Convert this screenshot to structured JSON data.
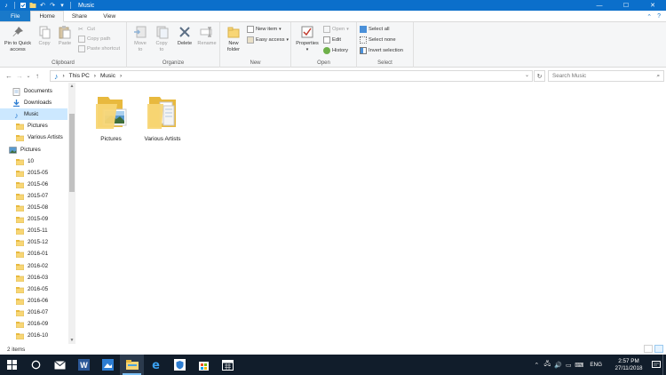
{
  "window": {
    "title": "Music",
    "controls": {
      "minimize": "—",
      "maximize": "☐",
      "close": "✕"
    }
  },
  "ribbon_tabs": [
    "File",
    "Home",
    "Share",
    "View"
  ],
  "ribbon": {
    "clipboard": {
      "label": "Clipboard",
      "pin": "Pin to Quick\naccess",
      "copy": "Copy",
      "paste": "Paste",
      "cut": "Cut",
      "copy_path": "Copy path",
      "paste_shortcut": "Paste shortcut"
    },
    "organize": {
      "label": "Organize",
      "move_to": "Move\nto",
      "copy_to": "Copy\nto",
      "delete": "Delete",
      "rename": "Rename"
    },
    "new": {
      "label": "New",
      "new_folder": "New\nfolder",
      "new_item": "New item",
      "easy_access": "Easy access"
    },
    "open": {
      "label": "Open",
      "properties": "Properties",
      "open": "Open",
      "edit": "Edit",
      "history": "History"
    },
    "select": {
      "label": "Select",
      "select_all": "Select all",
      "select_none": "Select none",
      "invert": "Invert selection"
    }
  },
  "address": {
    "breadcrumb": [
      "This PC",
      "Music"
    ],
    "search_placeholder": "Search Music"
  },
  "nav_pane": {
    "items": [
      {
        "label": "Documents",
        "icon": "documents-icon"
      },
      {
        "label": "Downloads",
        "icon": "downloads-icon"
      },
      {
        "label": "Music",
        "icon": "music-icon",
        "selected": true
      },
      {
        "label": "Pictures",
        "icon": "folder-icon"
      },
      {
        "label": "Various Artists",
        "icon": "folder-icon"
      },
      {
        "label": "Pictures",
        "icon": "pictures-icon"
      },
      {
        "label": "10",
        "icon": "folder-icon"
      },
      {
        "label": "2015-05",
        "icon": "folder-icon"
      },
      {
        "label": "2015-06",
        "icon": "folder-icon"
      },
      {
        "label": "2015-07",
        "icon": "folder-icon"
      },
      {
        "label": "2015-08",
        "icon": "folder-icon"
      },
      {
        "label": "2015-09",
        "icon": "folder-icon"
      },
      {
        "label": "2015-11",
        "icon": "folder-icon"
      },
      {
        "label": "2015-12",
        "icon": "folder-icon"
      },
      {
        "label": "2016-01",
        "icon": "folder-icon"
      },
      {
        "label": "2016-02",
        "icon": "folder-icon"
      },
      {
        "label": "2016-03",
        "icon": "folder-icon"
      },
      {
        "label": "2016-05",
        "icon": "folder-icon"
      },
      {
        "label": "2016-06",
        "icon": "folder-icon"
      },
      {
        "label": "2016-07",
        "icon": "folder-icon"
      },
      {
        "label": "2016-09",
        "icon": "folder-icon"
      },
      {
        "label": "2016-10",
        "icon": "folder-icon"
      }
    ]
  },
  "content": {
    "items": [
      {
        "label": "Pictures",
        "kind": "picture-folder"
      },
      {
        "label": "Various Artists",
        "kind": "document-folder"
      }
    ]
  },
  "status": {
    "item_count": "2 items"
  },
  "taskbar": {
    "apps": [
      "start-icon",
      "search-icon",
      "mail-icon",
      "word-icon",
      "photos-icon",
      "file-explorer-icon",
      "edge-icon",
      "defender-icon",
      "store-icon",
      "calendar-icon"
    ],
    "language": "ENG",
    "time": "2:57 PM",
    "date": "27/11/2018"
  },
  "colors": {
    "titlebar": "#0b6fcb",
    "file_tab": "#1979ca",
    "selection": "#cce8ff",
    "folder": "#f8d675",
    "taskbar": "#111d2b"
  }
}
